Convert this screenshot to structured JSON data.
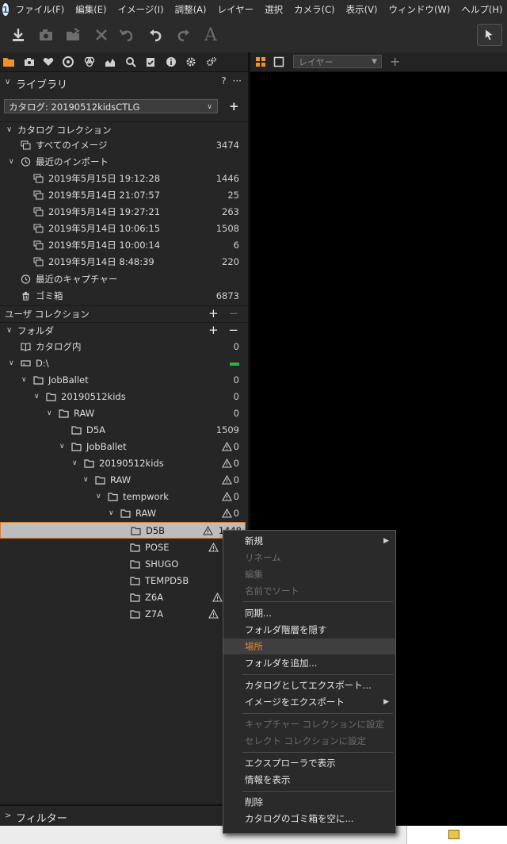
{
  "menubar": {
    "logo": "1",
    "items": [
      "ファイル(F)",
      "編集(E)",
      "イメージ(I)",
      "調整(A)",
      "レイヤー",
      "選択",
      "カメラ(C)",
      "表示(V)",
      "ウィンドウ(W)",
      "ヘルプ(H)"
    ]
  },
  "toolbar": {
    "text_tool_label": "A"
  },
  "viewer": {
    "layer_placeholder": "レイヤー"
  },
  "library": {
    "title": "ライブラリ",
    "help": "?",
    "more": "···",
    "catalog": "カタログ: 20190512kidsCTLG",
    "catalog_collection": {
      "title": "カタログ コレクション",
      "all_images": {
        "label": "すべてのイメージ",
        "count": "3474"
      },
      "recent_imports": {
        "label": "最近のインポート"
      },
      "imports": [
        {
          "label": "2019年5月15日 19:12:28",
          "count": "1446"
        },
        {
          "label": "2019年5月14日 21:07:57",
          "count": "25"
        },
        {
          "label": "2019年5月14日 19:27:21",
          "count": "263"
        },
        {
          "label": "2019年5月14日 10:06:15",
          "count": "1508"
        },
        {
          "label": "2019年5月14日 10:00:14",
          "count": "6"
        },
        {
          "label": "2019年5月14日 8:48:39",
          "count": "220"
        }
      ],
      "recent_captures": {
        "label": "最近のキャプチャー"
      },
      "trash": {
        "label": "ゴミ箱",
        "count": "6873"
      }
    },
    "user_collection": {
      "title": "ユーザ コレクション",
      "plus": "+",
      "minus": "−"
    },
    "folders": {
      "title": "フォルダ",
      "plus": "+",
      "minus": "−",
      "in_catalog": {
        "label": "カタログ内",
        "count": "0"
      },
      "tree": [
        {
          "label": "D:\\",
          "count": ""
        },
        {
          "label": "JobBallet",
          "count": "0"
        },
        {
          "label": "20190512kids",
          "count": "0"
        },
        {
          "label": "RAW",
          "count": "0"
        },
        {
          "label": "D5A",
          "count": "1509"
        },
        {
          "label": "JobBallet",
          "count": "0"
        },
        {
          "label": "20190512kids",
          "count": "0"
        },
        {
          "label": "RAW",
          "count": "0"
        },
        {
          "label": "tempwork",
          "count": "0"
        },
        {
          "label": "RAW",
          "count": "0"
        },
        {
          "label": "D5B",
          "count": "1448"
        },
        {
          "label": "POSE",
          "count": ""
        },
        {
          "label": "SHUGO",
          "count": ""
        },
        {
          "label": "TEMPD5B",
          "count": ""
        },
        {
          "label": "Z6A",
          "count": ""
        },
        {
          "label": "Z7A",
          "count": ""
        }
      ]
    },
    "filter_title": "フィルター"
  },
  "context_menu": {
    "items": [
      {
        "label": "新規",
        "disabled": false,
        "submenu": true
      },
      {
        "label": "リネーム",
        "disabled": true
      },
      {
        "label": "編集",
        "disabled": true
      },
      {
        "label": "名前でソート",
        "disabled": true
      },
      {
        "label": "同期...",
        "disabled": false
      },
      {
        "label": "フォルダ階層を隠す",
        "disabled": false
      },
      {
        "label": "場所",
        "disabled": false,
        "highlighted": true
      },
      {
        "label": "フォルダを追加...",
        "disabled": false
      },
      {
        "label": "カタログとしてエクスポート...",
        "disabled": false
      },
      {
        "label": "イメージをエクスポート",
        "disabled": false,
        "submenu": true
      },
      {
        "label": "キャプチャー コレクションに設定",
        "disabled": true
      },
      {
        "label": "セレクト コレクションに設定",
        "disabled": true
      },
      {
        "label": "エクスプローラで表示",
        "disabled": false
      },
      {
        "label": "情報を表示",
        "disabled": false
      },
      {
        "label": "削除",
        "disabled": false
      },
      {
        "label": "カタログのゴミ箱を空に...",
        "disabled": false
      }
    ]
  },
  "colors": {
    "accent": "#e8862a",
    "online": "#2bb24c"
  }
}
